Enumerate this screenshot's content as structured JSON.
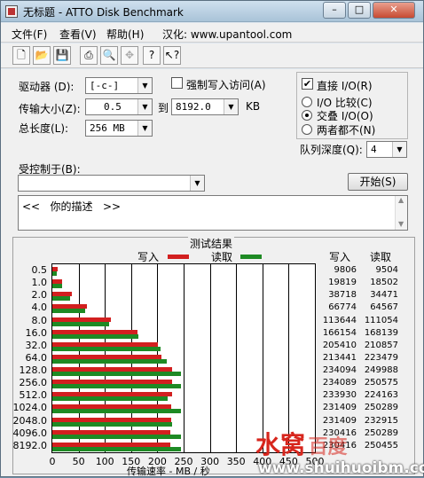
{
  "window": {
    "title": "无标题 - ATTO Disk Benchmark",
    "minimize": "–",
    "maximize": "□",
    "close": "✕"
  },
  "menu": {
    "file": "文件(F)",
    "view": "查看(V)",
    "help": "帮助(H)",
    "localized": "汉化: www.upantool.com"
  },
  "toolbar": {
    "icons": [
      "new-icon",
      "open-icon",
      "save-icon",
      "print-icon",
      "print-preview-icon",
      "move-icon",
      "help-icon",
      "context-help-icon"
    ]
  },
  "form": {
    "drive_label": "驱动器 (D):",
    "drive_value": "[-c-]",
    "force_write_label": "强制写入访问(A)",
    "transfer_label": "传输大小(Z):",
    "transfer_from": "0.5",
    "to_label": "到",
    "transfer_to": "8192.0",
    "kb_label": "KB",
    "total_length_label": "总长度(L):",
    "total_length_value": "256 MB",
    "direct_io_label": "直接 I/O(R)",
    "direct_io_checked": true,
    "io_compare_label": "I/O 比较(C)",
    "overlapped_io_label": "交叠 I/O(O)",
    "neither_label": "两者都不(N)",
    "queue_depth_label": "队列深度(Q):",
    "queue_depth_value": "4",
    "controlled_by_label": "受控制于(B):",
    "controlled_by_value": "",
    "start_button": "开始(S)",
    "description_text": "<<   你的描述   >>"
  },
  "results": {
    "group_title": "测试结果",
    "legend_write": "写入",
    "legend_read": "读取",
    "col_write": "写入",
    "col_read": "读取",
    "x_axis_title": "传输速率 - MB / 秒",
    "write_color": "#d21f1f",
    "read_color": "#1e8a24"
  },
  "chart_data": {
    "type": "bar",
    "orientation": "horizontal",
    "categories": [
      "0.5",
      "1.0",
      "2.0",
      "4.0",
      "8.0",
      "16.0",
      "32.0",
      "64.0",
      "128.0",
      "256.0",
      "512.0",
      "1024.0",
      "2048.0",
      "4096.0",
      "8192.0"
    ],
    "series": [
      {
        "name": "写入",
        "values": [
          9806,
          19819,
          38718,
          66774,
          113644,
          166154,
          205410,
          213441,
          234094,
          234089,
          233930,
          231409,
          231409,
          230416,
          230416
        ]
      },
      {
        "name": "读取",
        "values": [
          9504,
          18502,
          34471,
          64567,
          111054,
          168139,
          210857,
          223479,
          249988,
          250575,
          224163,
          250289,
          232915,
          250289,
          250455
        ]
      }
    ],
    "value_unit": "KB/s",
    "xlabel": "传输速率 - MB / 秒",
    "xticks": [
      "0",
      "50",
      "100",
      "150",
      "200",
      "250",
      "300",
      "350",
      "400",
      "450",
      "500"
    ],
    "xlim": [
      0,
      500
    ],
    "grid": true,
    "legend": "top"
  },
  "watermark": {
    "brand": "水窝",
    "brand_tail": "百度",
    "url": "www.shuihuoibm.com"
  }
}
